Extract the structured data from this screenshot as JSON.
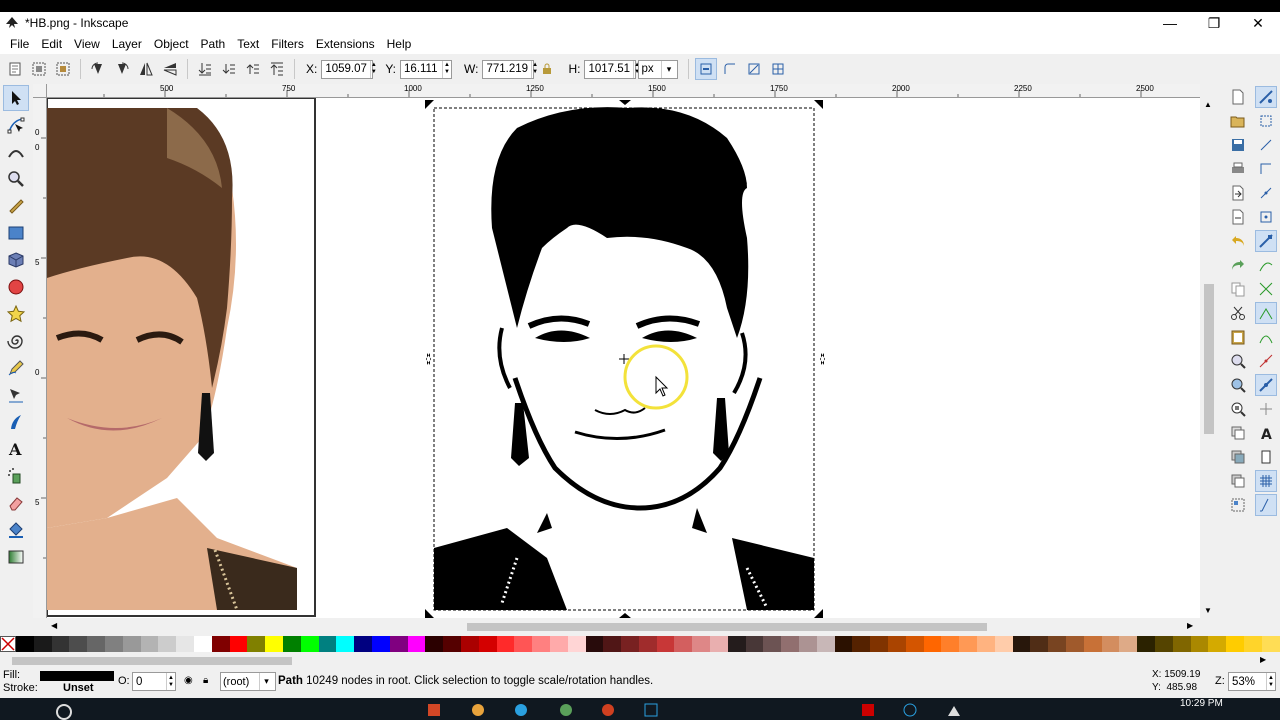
{
  "window": {
    "title": "*HB.png - Inkscape",
    "minimize": "—",
    "restore": "❐",
    "close": "✕"
  },
  "menu": [
    "File",
    "Edit",
    "View",
    "Layer",
    "Object",
    "Path",
    "Text",
    "Filters",
    "Extensions",
    "Help"
  ],
  "toolbar": {
    "x_label": "X:",
    "x_value": "1059.07",
    "y_label": "Y:",
    "y_value": "16.111",
    "w_label": "W:",
    "w_value": "771.219",
    "h_label": "H:",
    "h_value": "1017.51",
    "unit": "px"
  },
  "rulers": {
    "h_ticks": [
      "500",
      "750",
      "1000",
      "1250",
      "1500",
      "1750",
      "2000",
      "2250",
      "2500"
    ],
    "v_ticks": [
      "0",
      "0",
      "5",
      "0",
      "5"
    ]
  },
  "status": {
    "fill_label": "Fill:",
    "stroke_label": "Stroke:",
    "stroke_value": "Unset",
    "opacity_label": "O:",
    "opacity_value": "0",
    "layer": "(root)",
    "message_bold": "Path",
    "message": " 10249 nodes in root. Click selection to toggle scale/rotation handles.",
    "cursor_x": "X: 1509.19",
    "cursor_y": "Y:  485.98",
    "zoom_label": "Z:",
    "zoom_value": "53%"
  },
  "taskbar": {
    "time": "10:29 PM"
  },
  "colors": {
    "selection": "#000000",
    "cursor_highlight": "#f3e23a",
    "active_tool_bg": "#cfe0f4"
  }
}
